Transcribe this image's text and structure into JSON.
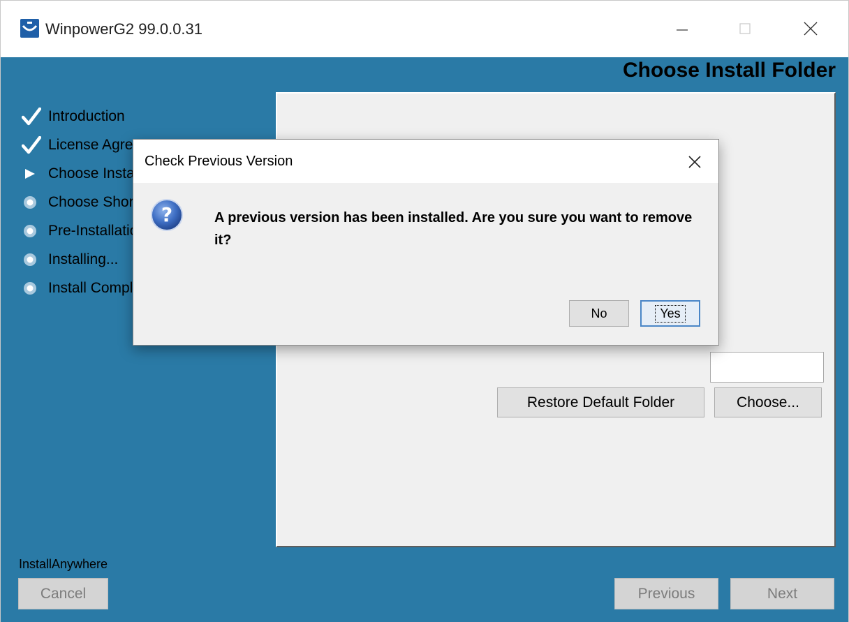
{
  "window": {
    "title": "WinpowerG2 99.0.0.31"
  },
  "installer": {
    "header_title": "Choose Install Folder",
    "steps": [
      {
        "label": "Introduction",
        "state": "done",
        "icon": "check-icon"
      },
      {
        "label": "License Agreement",
        "state": "done",
        "icon": "check-icon"
      },
      {
        "label": "Choose Install Folder",
        "state": "current",
        "icon": "triangle-right-icon"
      },
      {
        "label": "Choose Shortcut Folder",
        "state": "pending",
        "icon": "bullet-icon"
      },
      {
        "label": "Pre-Installation Summary",
        "state": "pending",
        "icon": "bullet-icon"
      },
      {
        "label": "Installing...",
        "state": "pending",
        "icon": "bullet-icon"
      },
      {
        "label": "Install Complete",
        "state": "pending",
        "icon": "bullet-icon"
      }
    ],
    "restore_default_label": "Restore Default Folder",
    "choose_label": "Choose...",
    "brand": "InstallAnywhere",
    "cancel_label": "Cancel",
    "previous_label": "Previous",
    "next_label": "Next"
  },
  "dialog": {
    "title": "Check Previous Version",
    "message": "A previous version has been installed. Are you sure you want to remove it?",
    "no_label": "No",
    "yes_label": "Yes",
    "icon": "question-icon"
  },
  "colors": {
    "installer_bg": "#2a7aa6",
    "panel_bg": "#f0f0f0",
    "dialog_default_border": "#4a86c7"
  }
}
